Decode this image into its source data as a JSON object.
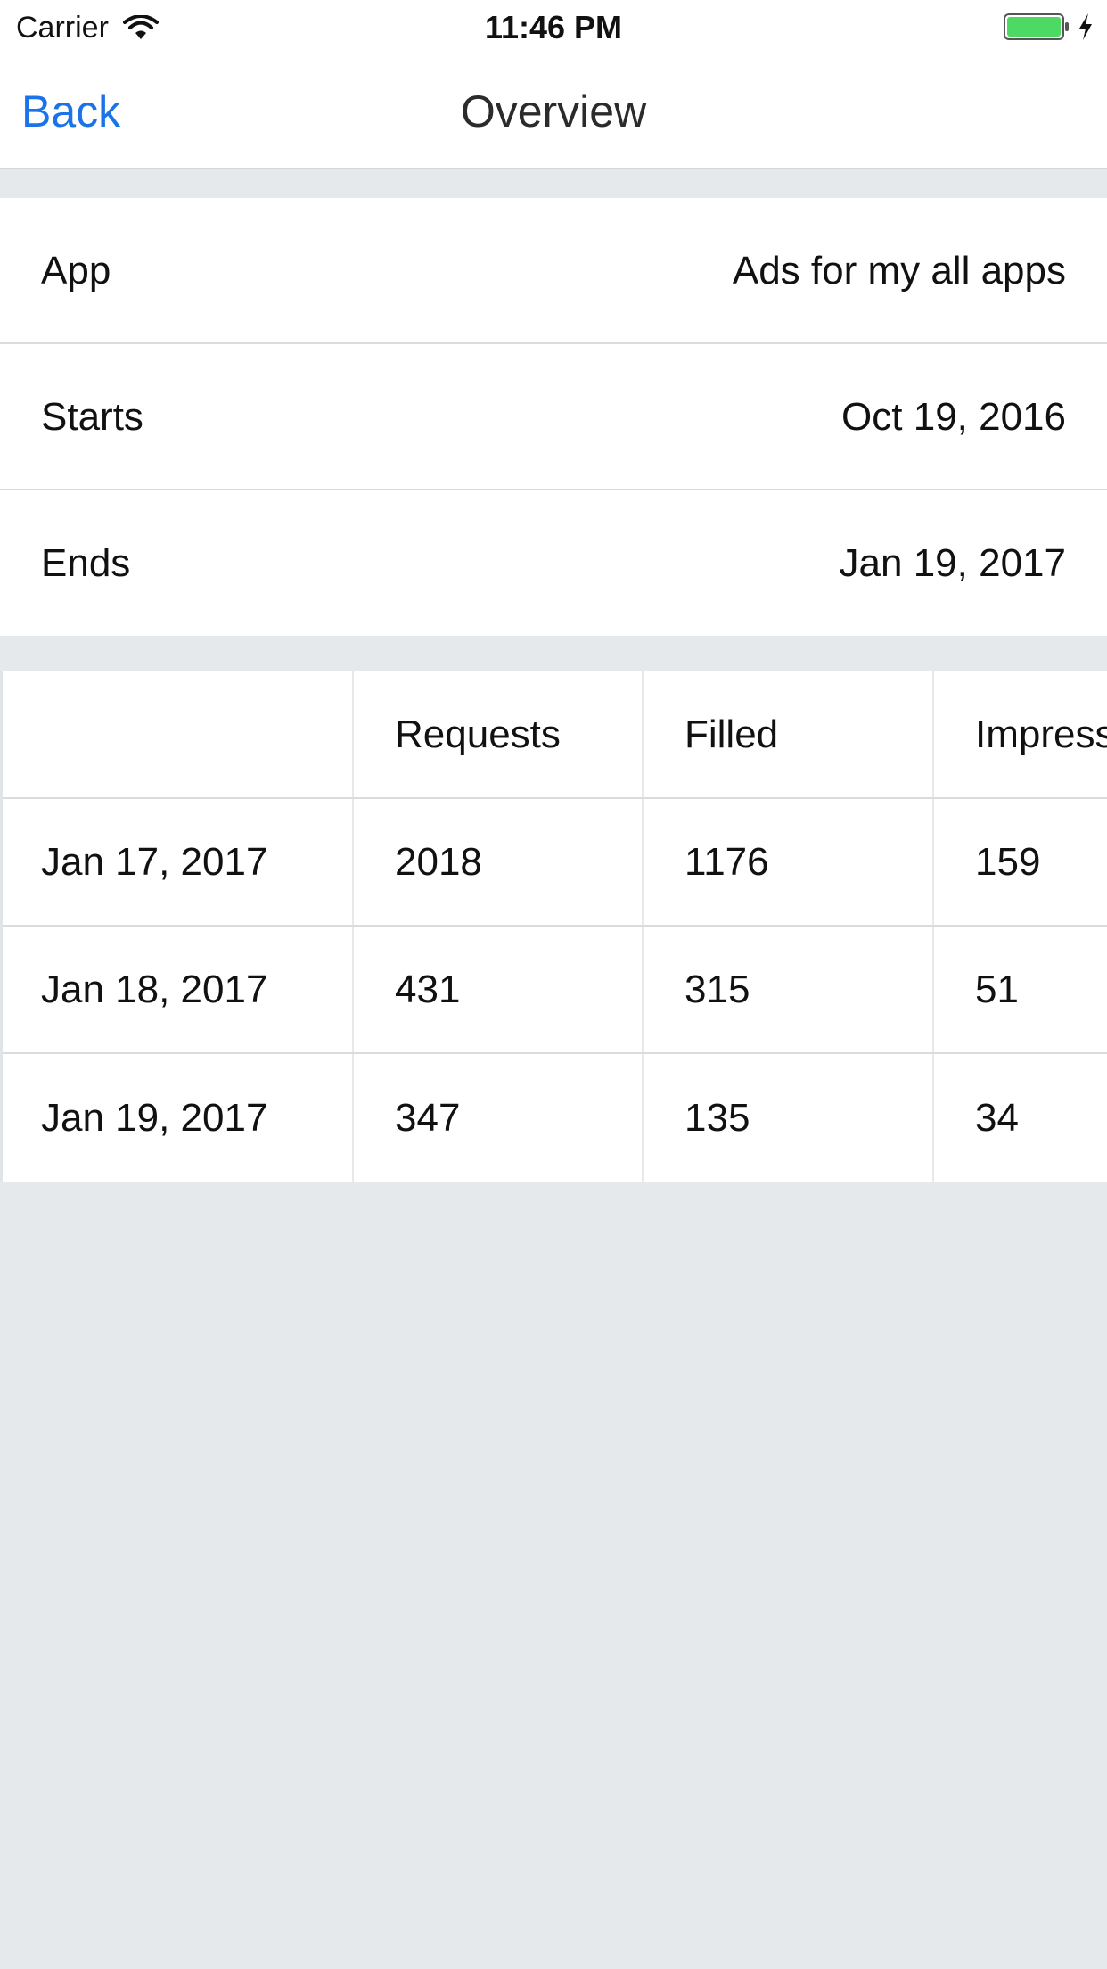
{
  "status_bar": {
    "carrier": "Carrier",
    "time": "11:46 PM",
    "battery_color": "#4cd964"
  },
  "nav": {
    "back_label": "Back",
    "title": "Overview"
  },
  "info": {
    "rows": [
      {
        "label": "App",
        "value": "Ads for my all apps"
      },
      {
        "label": "Starts",
        "value": "Oct 19, 2016"
      },
      {
        "label": "Ends",
        "value": "Jan 19, 2017"
      }
    ]
  },
  "table": {
    "columns": [
      "",
      "Requests",
      "Filled",
      "Impressions"
    ],
    "rows": [
      [
        "Jan 17, 2017",
        "2018",
        "1176",
        "159"
      ],
      [
        "Jan 18, 2017",
        "431",
        "315",
        "51"
      ],
      [
        "Jan 19, 2017",
        "347",
        "135",
        "34"
      ]
    ]
  },
  "colors": {
    "accent": "#1a73e8",
    "background": "#e6e9ec"
  }
}
